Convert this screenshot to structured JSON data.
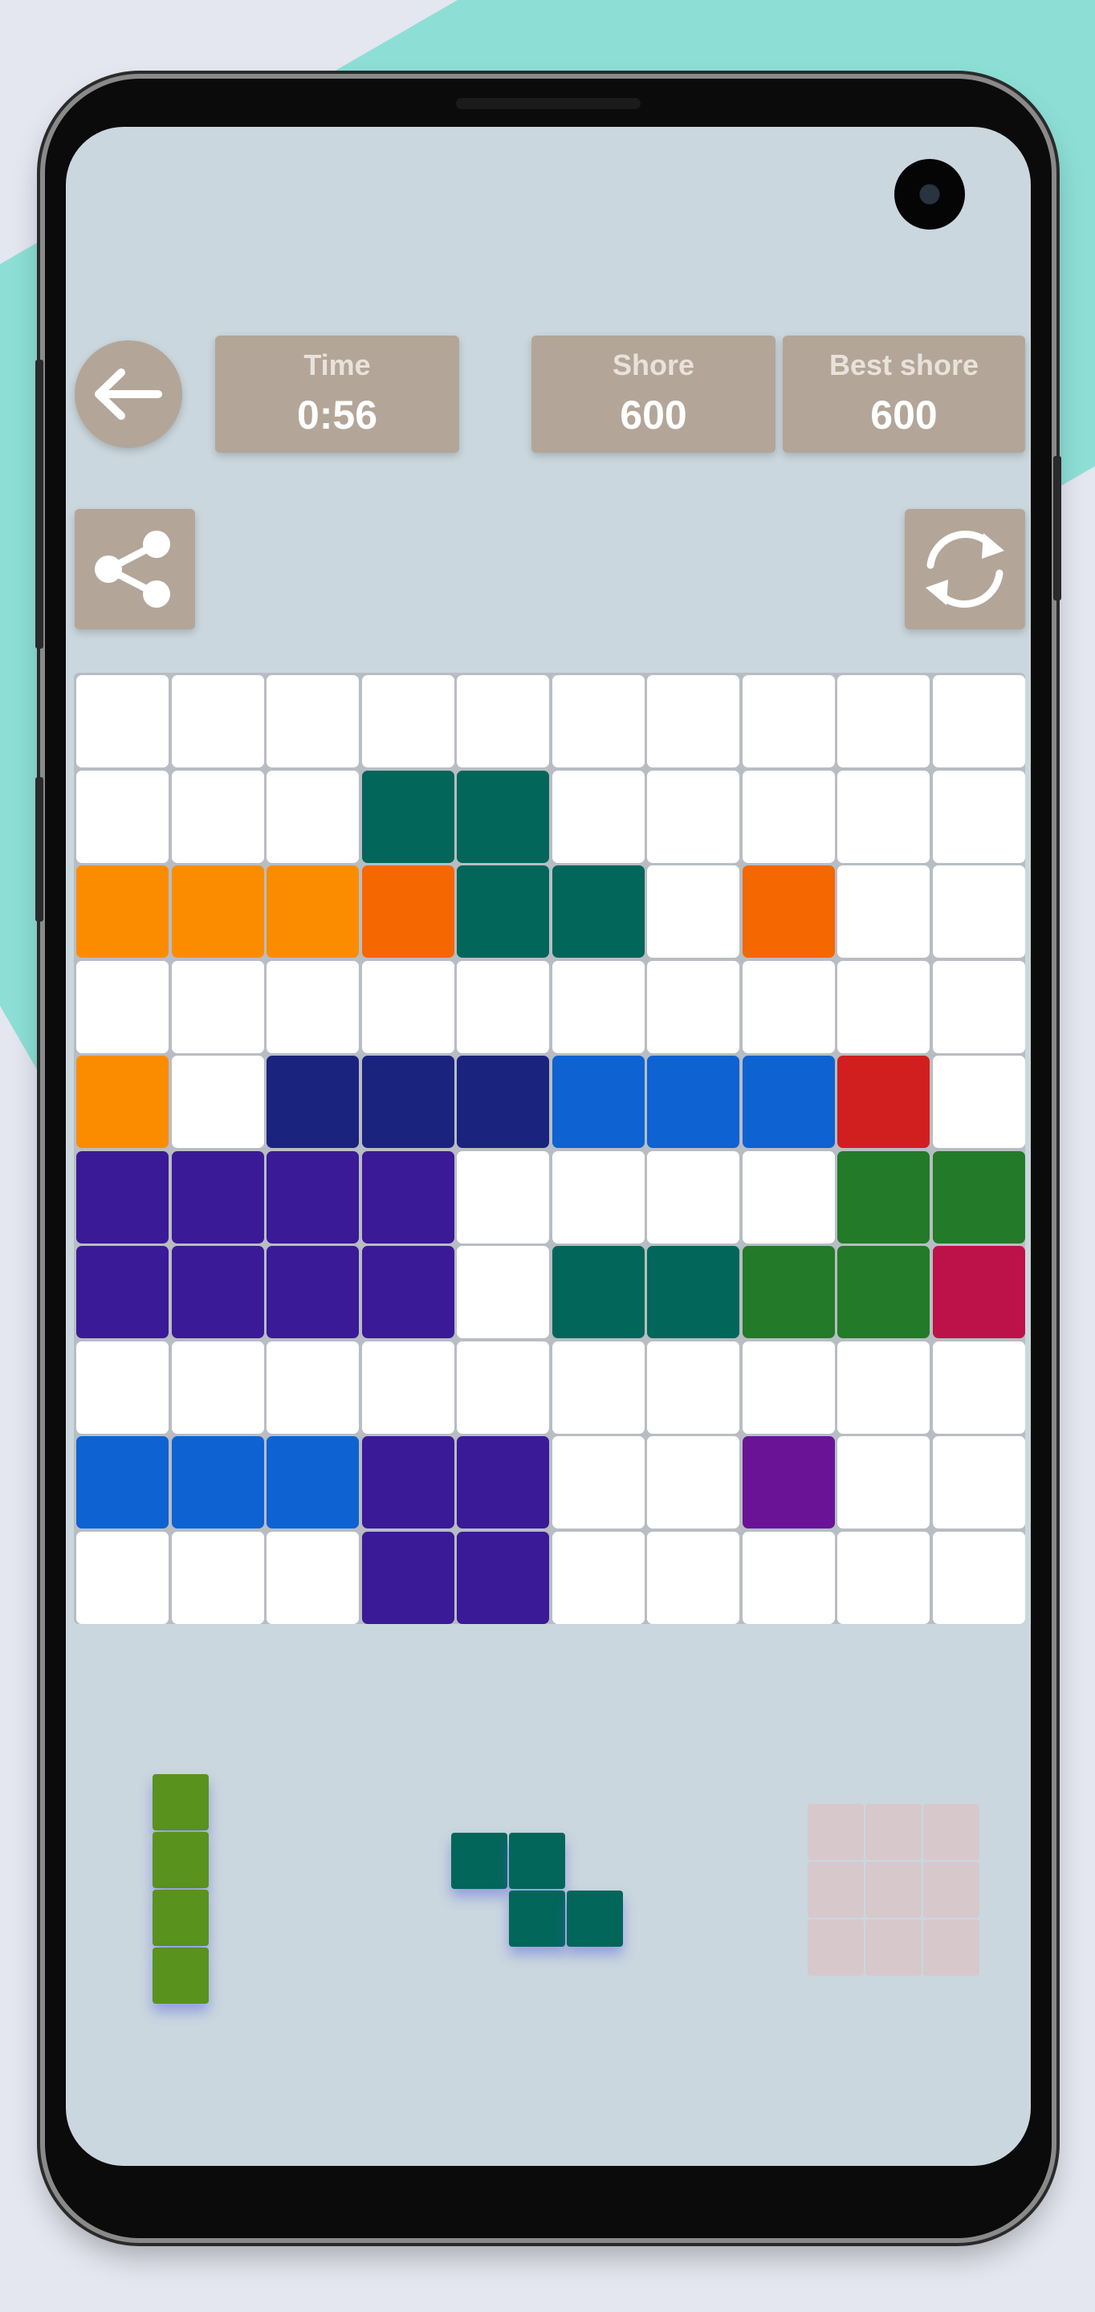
{
  "colors": {
    "empty": "#ffffff",
    "teal": "#03665a",
    "orange": "#fb8c00",
    "deep_orange": "#f56700",
    "navy": "#1a237e",
    "blue": "#0e62d1",
    "red": "#d11e1e",
    "purple": "#3a1a96",
    "green": "#237a28",
    "pink": "#bd1149",
    "violet": "#6a1396",
    "lime_green": "#5a921e",
    "ghost": "#d7c8cc"
  },
  "header": {
    "back_icon": "arrow-left-icon",
    "time": {
      "label": "Time",
      "value": "0:56"
    },
    "score": {
      "label": "Shore",
      "value": "600"
    },
    "best": {
      "label": "Best shore",
      "value": "600"
    }
  },
  "toolbar": {
    "share_icon": "share-icon",
    "restart_icon": "refresh-icon"
  },
  "board": {
    "rows": 10,
    "cols": 10,
    "grid": [
      [
        "empty",
        "empty",
        "empty",
        "empty",
        "empty",
        "empty",
        "empty",
        "empty",
        "empty",
        "empty"
      ],
      [
        "empty",
        "empty",
        "empty",
        "teal",
        "teal",
        "empty",
        "empty",
        "empty",
        "empty",
        "empty"
      ],
      [
        "orange",
        "orange",
        "orange",
        "deep_orange",
        "teal",
        "teal",
        "empty",
        "deep_orange",
        "empty",
        "empty"
      ],
      [
        "empty",
        "empty",
        "empty",
        "empty",
        "empty",
        "empty",
        "empty",
        "empty",
        "empty",
        "empty"
      ],
      [
        "orange",
        "empty",
        "navy",
        "navy",
        "navy",
        "blue",
        "blue",
        "blue",
        "red",
        "empty"
      ],
      [
        "purple",
        "purple",
        "purple",
        "purple",
        "empty",
        "empty",
        "empty",
        "empty",
        "green",
        "green"
      ],
      [
        "purple",
        "purple",
        "purple",
        "purple",
        "empty",
        "teal",
        "teal",
        "green",
        "green",
        "pink"
      ],
      [
        "empty",
        "empty",
        "empty",
        "empty",
        "empty",
        "empty",
        "empty",
        "empty",
        "empty",
        "empty"
      ],
      [
        "blue",
        "blue",
        "blue",
        "purple",
        "purple",
        "empty",
        "empty",
        "violet",
        "empty",
        "empty"
      ],
      [
        "empty",
        "empty",
        "empty",
        "purple",
        "purple",
        "empty",
        "empty",
        "empty",
        "empty",
        "empty"
      ]
    ]
  },
  "tray": {
    "pieces": [
      {
        "name": "vertical-i-piece",
        "color": "lime_green",
        "cells": [
          [
            0,
            0
          ],
          [
            1,
            0
          ],
          [
            2,
            0
          ],
          [
            3,
            0
          ]
        ],
        "playable": true
      },
      {
        "name": "z-piece",
        "color": "teal",
        "cells": [
          [
            0,
            0
          ],
          [
            0,
            1
          ],
          [
            1,
            1
          ],
          [
            1,
            2
          ]
        ],
        "playable": true
      },
      {
        "name": "square-3x3-piece",
        "color": "ghost",
        "cells": [
          [
            0,
            0
          ],
          [
            0,
            1
          ],
          [
            0,
            2
          ],
          [
            1,
            0
          ],
          [
            1,
            1
          ],
          [
            1,
            2
          ],
          [
            2,
            0
          ],
          [
            2,
            1
          ],
          [
            2,
            2
          ]
        ],
        "playable": false
      }
    ]
  }
}
